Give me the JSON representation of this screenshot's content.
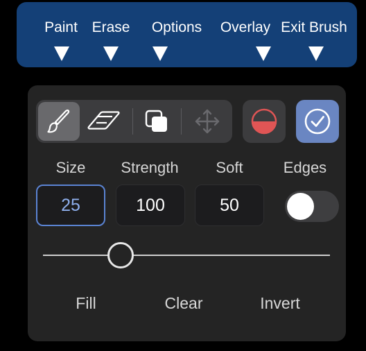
{
  "callout": {
    "items": [
      {
        "label": "Paint",
        "icon": "down-arrow-icon"
      },
      {
        "label": "Erase",
        "icon": "down-arrow-icon"
      },
      {
        "label": "Options",
        "icon": "down-arrow-icon"
      },
      {
        "label": "Overlay",
        "icon": "down-arrow-icon"
      },
      {
        "label": "Exit Brush",
        "icon": "down-arrow-icon"
      }
    ],
    "color": "#144077"
  },
  "tools": [
    {
      "icon": "paint-brush-icon",
      "state": "selected"
    },
    {
      "icon": "eraser-icon",
      "state": "default"
    },
    {
      "icon": "overlap-squares-icon",
      "state": "default"
    },
    {
      "icon": "move-arrows-icon",
      "state": "disabled"
    }
  ],
  "overlay": {
    "icon": "half-circle-icon",
    "color": "#e05555"
  },
  "exit": {
    "icon": "checkmark-circle-icon",
    "color": "#6a86c2"
  },
  "params": {
    "size": {
      "label": "Size",
      "value": "25"
    },
    "strength": {
      "label": "Strength",
      "value": "100"
    },
    "soft": {
      "label": "Soft",
      "value": "50"
    },
    "edges": {
      "label": "Edges",
      "on": false
    }
  },
  "slider": {
    "value": 0.27
  },
  "actions": {
    "fill": "Fill",
    "clear": "Clear",
    "invert": "Invert"
  }
}
